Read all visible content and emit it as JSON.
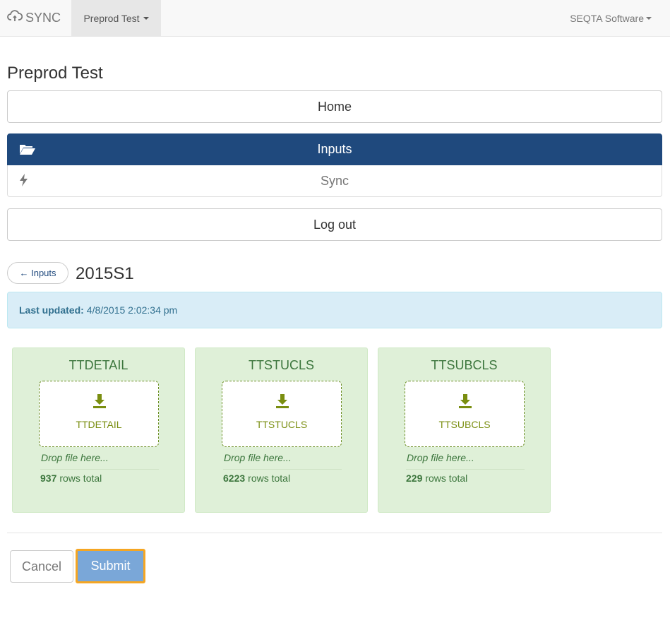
{
  "navbar": {
    "brand": "SYNC",
    "dropdown_label": "Preprod Test",
    "right_label": "SEQTA Software"
  },
  "page": {
    "title": "Preprod Test"
  },
  "menu": {
    "home": "Home",
    "inputs": "Inputs",
    "sync": "Sync",
    "logout": "Log out"
  },
  "section": {
    "back_label": "← Inputs",
    "title": "2015S1",
    "last_updated_label": "Last updated:",
    "last_updated_value": "4/8/2015 2:02:34 pm"
  },
  "uploads": [
    {
      "title": "TTDETAIL",
      "dropzone_label": "TTDETAIL",
      "hint": "Drop file here...",
      "rows": "937",
      "rows_suffix": "rows total"
    },
    {
      "title": "TTSTUCLS",
      "dropzone_label": "TTSTUCLS",
      "hint": "Drop file here...",
      "rows": "6223",
      "rows_suffix": "rows total"
    },
    {
      "title": "TTSUBCLS",
      "dropzone_label": "TTSUBCLS",
      "hint": "Drop file here...",
      "rows": "229",
      "rows_suffix": "rows total"
    }
  ],
  "actions": {
    "cancel": "Cancel",
    "submit": "Submit"
  },
  "colors": {
    "primary": "#1f497d",
    "panel_bg": "#dff0d8",
    "highlight": "#f5a623"
  },
  "icons": {
    "brand": "cloud-sync-icon",
    "inputs": "folder-open-icon",
    "sync": "lightning-icon",
    "dropzone": "download-icon"
  }
}
